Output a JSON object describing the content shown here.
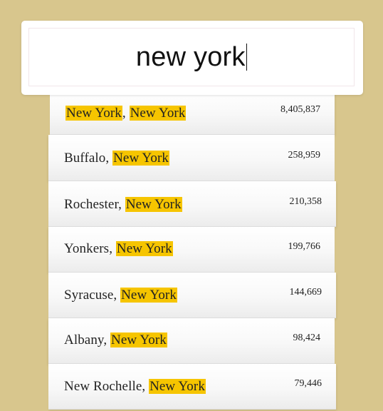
{
  "search": {
    "query": "new york"
  },
  "results": [
    {
      "city": "New York",
      "state": "New York",
      "population": "8,405,837",
      "city_highlighted": true
    },
    {
      "city": "Buffalo",
      "state": "New York",
      "population": "258,959",
      "city_highlighted": false
    },
    {
      "city": "Rochester",
      "state": "New York",
      "population": "210,358",
      "city_highlighted": false
    },
    {
      "city": "Yonkers",
      "state": "New York",
      "population": "199,766",
      "city_highlighted": false
    },
    {
      "city": "Syracuse",
      "state": "New York",
      "population": "144,669",
      "city_highlighted": false
    },
    {
      "city": "Albany",
      "state": "New York",
      "population": "98,424",
      "city_highlighted": false
    },
    {
      "city": "New Rochelle",
      "state": "New York",
      "population": "79,446",
      "city_highlighted": false
    }
  ],
  "colors": {
    "background": "#d8c68d",
    "highlight": "#f6c500",
    "card": "#ffffff"
  }
}
